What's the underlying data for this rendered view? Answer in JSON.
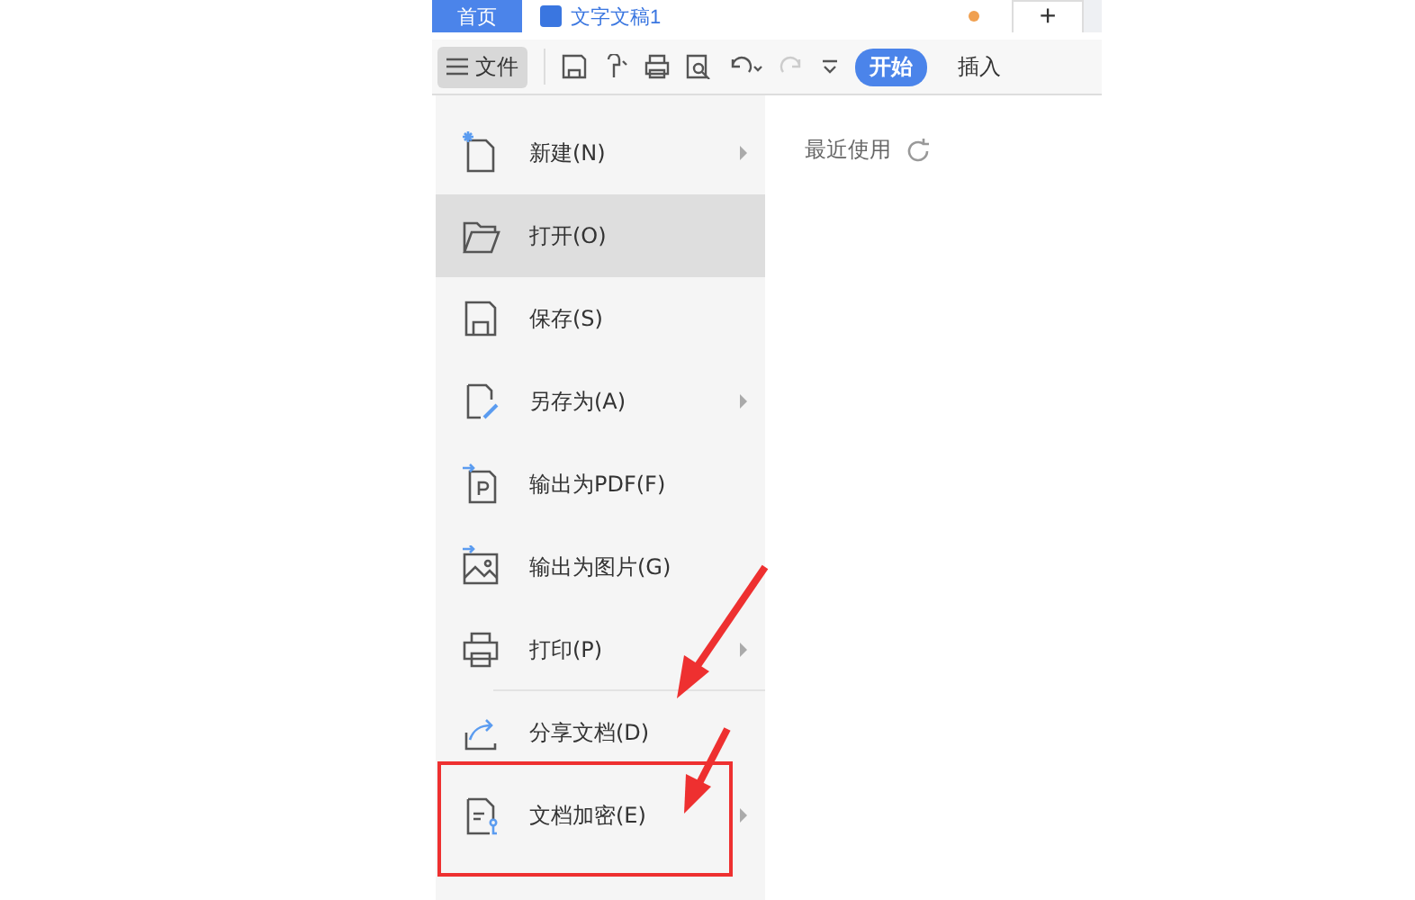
{
  "tabs": [
    {
      "label": "首页",
      "kind": "home",
      "selected": true
    },
    {
      "label": "文字文稿1",
      "kind": "doc",
      "selected": false,
      "unsaved": true
    },
    {
      "label": "+",
      "kind": "new",
      "selected": false
    }
  ],
  "toolbar": {
    "file_button": "文件",
    "ribbon_tabs": [
      {
        "label": "开始",
        "selected": true
      },
      {
        "label": "插入",
        "selected": false
      }
    ]
  },
  "menu": [
    {
      "label": "新建(N)",
      "submenu": true,
      "selected": false,
      "divider": false
    },
    {
      "label": "打开(O)",
      "submenu": false,
      "selected": true,
      "divider": false
    },
    {
      "label": "保存(S)",
      "submenu": false,
      "selected": false,
      "divider": false
    },
    {
      "label": "另存为(A)",
      "submenu": true,
      "selected": false,
      "divider": false
    },
    {
      "label": "输出为PDF(F)",
      "submenu": false,
      "selected": false,
      "divider": false
    },
    {
      "label": "输出为图片(G)",
      "submenu": false,
      "selected": false,
      "divider": false
    },
    {
      "label": "打印(P)",
      "submenu": true,
      "selected": false,
      "divider": true
    },
    {
      "label": "分享文档(D)",
      "submenu": false,
      "selected": false,
      "divider": false
    },
    {
      "label": "文档加密(E)",
      "submenu": true,
      "selected": false,
      "divider": false,
      "highlighted": true
    }
  ],
  "recent": {
    "title": "最近使用"
  }
}
